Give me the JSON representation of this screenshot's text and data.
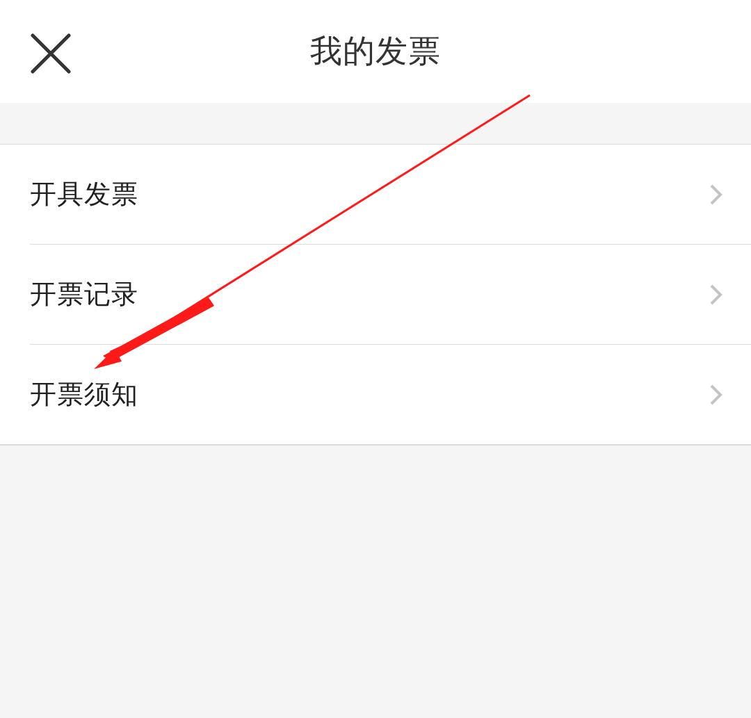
{
  "header": {
    "title": "我的发票"
  },
  "menu_items": [
    {
      "label": "开具发票"
    },
    {
      "label": "开票记录"
    },
    {
      "label": "开票须知"
    }
  ]
}
